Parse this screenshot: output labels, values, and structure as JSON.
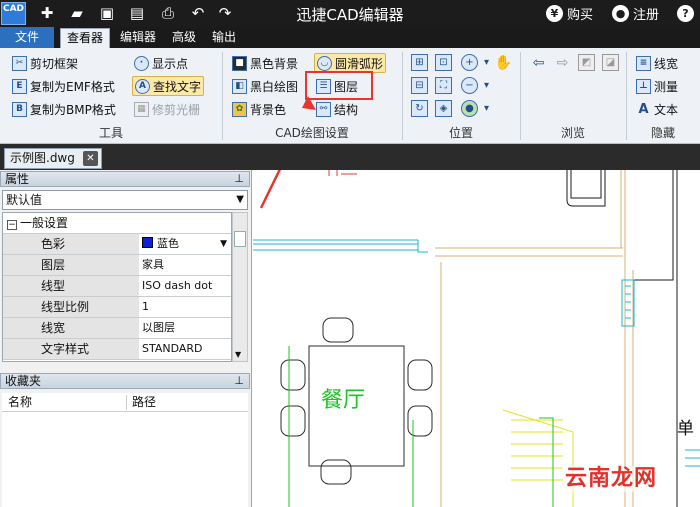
{
  "title": "迅捷CAD编辑器",
  "logo": {
    "top": "",
    "bottom": "CAD"
  },
  "title_actions": {
    "buy": "购买",
    "register": "注册",
    "help": "?"
  },
  "menu": {
    "file": "文件",
    "tabs": [
      "查看器",
      "编辑器",
      "高级",
      "输出"
    ]
  },
  "ribbon": {
    "tools": {
      "label": "工具",
      "items": [
        "剪切框架",
        "复制为EMF格式",
        "复制为BMP格式",
        "显示点",
        "查找文字",
        "修剪光栅"
      ]
    },
    "cad_settings": {
      "label": "CAD绘图设置",
      "items": [
        "黑色背景",
        "黑白绘图",
        "背景色",
        "圆滑弧形",
        "图层",
        "结构"
      ]
    },
    "position": {
      "label": "位置"
    },
    "browse": {
      "label": "浏览"
    },
    "hide": {
      "label": "隐藏",
      "items": [
        "线宽",
        "测量",
        "文本"
      ]
    }
  },
  "document_tab": "示例图.dwg",
  "properties": {
    "header": "属性",
    "selector": "默认值",
    "section": "一般设置",
    "rows": [
      {
        "key": "色彩",
        "value": "蓝色"
      },
      {
        "key": "图层",
        "value": "家具"
      },
      {
        "key": "线型",
        "value": "ISO dash dot"
      },
      {
        "key": "线型比例",
        "value": "1"
      },
      {
        "key": "线宽",
        "value": "以图层"
      },
      {
        "key": "文字样式",
        "value": "STANDARD"
      }
    ]
  },
  "favorites": {
    "header": "收藏夹",
    "columns": [
      "名称",
      "路径"
    ]
  },
  "drawing": {
    "room_label": "餐厅",
    "side_label": "单"
  },
  "watermark": "云南龙网",
  "colors": {
    "highlight": "#e8352f",
    "blue_swatch": "#0b20d8",
    "room_text": "#19c51f"
  }
}
